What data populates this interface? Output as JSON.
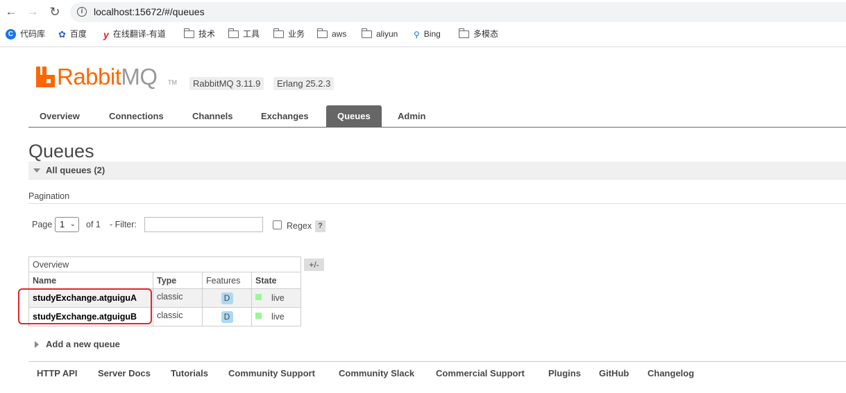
{
  "browser": {
    "url": "localhost:15672/#/queues",
    "bookmarks": [
      {
        "label": "代码库",
        "icon": "c-icon"
      },
      {
        "label": "百度",
        "icon": "paw-icon"
      },
      {
        "label": "在线翻译-有道",
        "icon": "youdao-icon"
      },
      {
        "label": "技术",
        "icon": "folder-icon"
      },
      {
        "label": "工具",
        "icon": "folder-icon"
      },
      {
        "label": "业务",
        "icon": "folder-icon"
      },
      {
        "label": "aws",
        "icon": "folder-icon"
      },
      {
        "label": "aliyun",
        "icon": "folder-icon"
      },
      {
        "label": "Bing",
        "icon": "search-icon"
      },
      {
        "label": "多模态",
        "icon": "folder-icon"
      }
    ]
  },
  "header": {
    "logo_rabbit": "Rabbit",
    "logo_mq": "MQ",
    "logo_tm": "TM",
    "version": "RabbitMQ 3.11.9",
    "erlang": "Erlang 25.2.3"
  },
  "tabs": [
    {
      "label": "Overview",
      "active": false
    },
    {
      "label": "Connections",
      "active": false
    },
    {
      "label": "Channels",
      "active": false
    },
    {
      "label": "Exchanges",
      "active": false
    },
    {
      "label": "Queues",
      "active": true
    },
    {
      "label": "Admin",
      "active": false
    }
  ],
  "page": {
    "title": "Queues",
    "section_label": "All queues (2)",
    "pagination_label": "Pagination",
    "page_label": "Page",
    "page_value": "1",
    "of_label": "of 1",
    "filter_label": "- Filter:",
    "filter_value": "",
    "regex_label": "Regex",
    "help_label": "?",
    "add_queue_label": "Add a new queue"
  },
  "table": {
    "group_header": "Overview",
    "toggle_columns": "+/-",
    "columns": [
      "Name",
      "Type",
      "Features",
      "State"
    ],
    "rows": [
      {
        "name": "studyExchange.atguiguA",
        "type": "classic",
        "feature": "D",
        "state": "live"
      },
      {
        "name": "studyExchange.atguiguB",
        "type": "classic",
        "feature": "D",
        "state": "live"
      }
    ]
  },
  "footer": {
    "links": [
      "HTTP API",
      "Server Docs",
      "Tutorials",
      "Community Support",
      "Community Slack",
      "Commercial Support",
      "Plugins",
      "GitHub",
      "Changelog"
    ]
  },
  "colors": {
    "brand_orange": "#ff6600",
    "active_tab": "#666666",
    "highlight": "#e0242b",
    "live_state": "#98f898",
    "feature_badge": "#add8f2"
  }
}
